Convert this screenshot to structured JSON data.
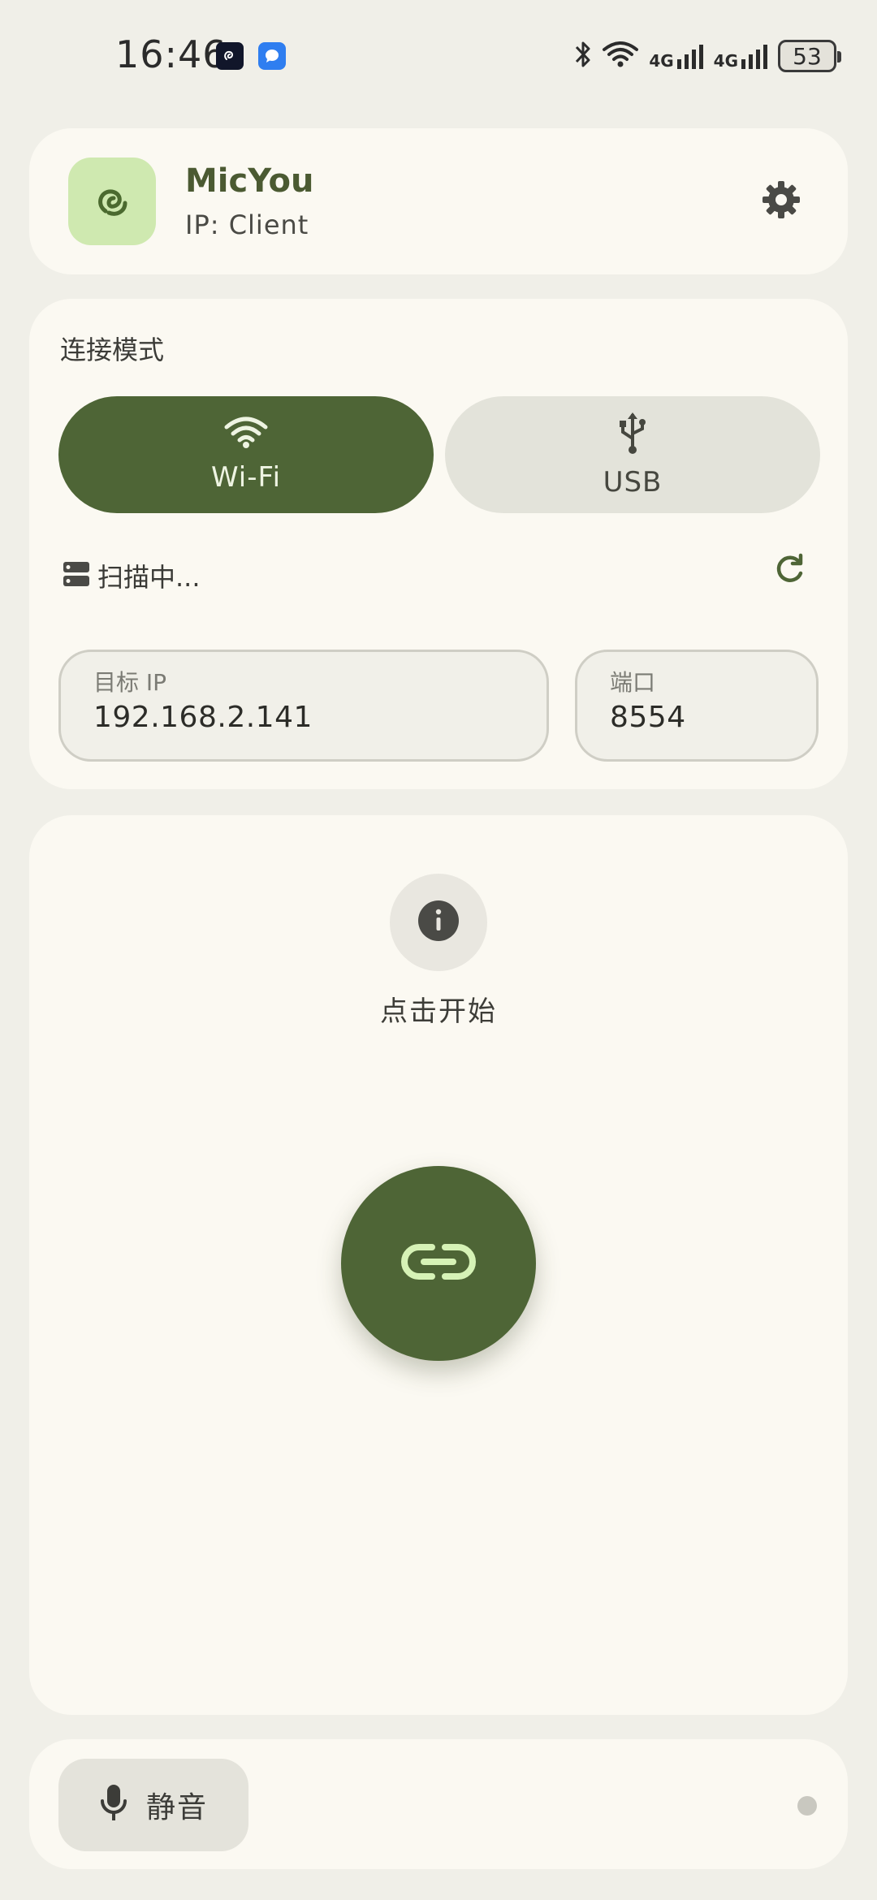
{
  "status_bar": {
    "time": "16:46",
    "network_1": "4G",
    "network_2": "4G",
    "battery": "53"
  },
  "header": {
    "app_name": "MicYou",
    "ip_label": "IP:  Client"
  },
  "connection": {
    "section_title": "连接模式",
    "modes": [
      {
        "label": "Wi-Fi",
        "selected": true
      },
      {
        "label": "USB",
        "selected": false
      }
    ],
    "scan_status": "扫描中...",
    "target_ip_label": "目标 IP",
    "target_ip_value": "192.168.2.141",
    "port_label": "端口",
    "port_value": "8554"
  },
  "main": {
    "hint": "点击开始"
  },
  "bottom": {
    "mute_label": "静音"
  },
  "colors": {
    "primary": "#4e6536",
    "background": "#f0efe8",
    "card": "#fbf9f2",
    "logo_bg": "#cfe9b0"
  }
}
